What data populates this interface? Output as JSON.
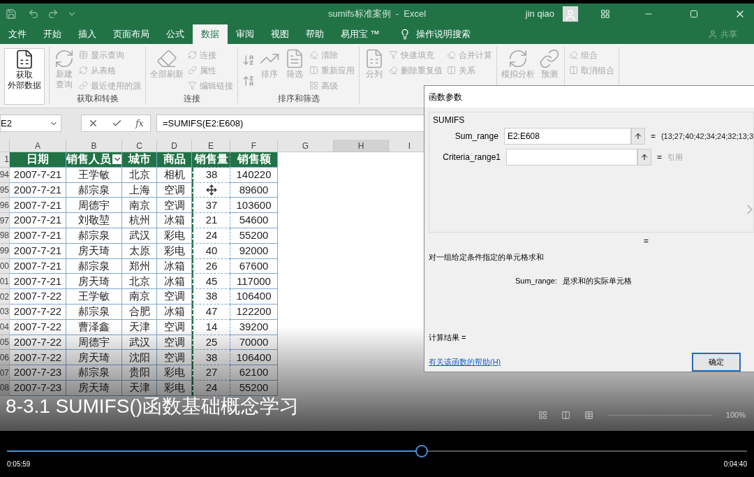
{
  "window": {
    "title": "sumifs标准案例  -  Excel",
    "user": "jin qiao"
  },
  "tabs": [
    {
      "label": "文件",
      "selected": false
    },
    {
      "label": "开始",
      "selected": false
    },
    {
      "label": "插入",
      "selected": false
    },
    {
      "label": "页面布局",
      "selected": false
    },
    {
      "label": "公式",
      "selected": false
    },
    {
      "label": "数据",
      "selected": true
    },
    {
      "label": "审阅",
      "selected": false
    },
    {
      "label": "视图",
      "selected": false
    },
    {
      "label": "帮助",
      "selected": false
    },
    {
      "label": "易用宝 ™",
      "selected": false
    }
  ],
  "tell_me": "操作说明搜索",
  "share": "共享",
  "ribbon": {
    "groups": [
      {
        "items": [
          {
            "lines": [
              "获取",
              "外部数据"
            ],
            "kind": "large",
            "disabled": false
          }
        ]
      },
      {
        "label": "获取和转换",
        "items": [
          {
            "lines": [
              "新建",
              "查询"
            ],
            "kind": "large",
            "disabled": true
          },
          {
            "kind": "stack",
            "items": [
              {
                "label": "显示查询",
                "disabled": true
              },
              {
                "label": "从表格",
                "disabled": true
              },
              {
                "label": "最近使用的源",
                "disabled": true
              }
            ]
          }
        ]
      },
      {
        "label": "连接",
        "items": [
          {
            "lines": [
              "全部刷新"
            ],
            "kind": "large",
            "disabled": true
          },
          {
            "kind": "stack",
            "items": [
              {
                "label": "连接",
                "disabled": true
              },
              {
                "label": "属性",
                "disabled": true
              },
              {
                "label": "编辑链接",
                "disabled": true
              }
            ]
          }
        ]
      },
      {
        "label": "排序和筛选",
        "items": [
          {
            "kind": "sort",
            "disabled": true
          },
          {
            "lines": [
              "排序"
            ],
            "kind": "large",
            "disabled": true
          },
          {
            "lines": [
              "筛选"
            ],
            "kind": "large",
            "disabled": true
          },
          {
            "kind": "stack",
            "items": [
              {
                "label": "清除",
                "disabled": true
              },
              {
                "label": "重新应用",
                "disabled": true
              },
              {
                "label": "高级",
                "disabled": true
              }
            ]
          }
        ]
      },
      {
        "items": [
          {
            "lines": [
              "分列"
            ],
            "kind": "large",
            "disabled": true
          },
          {
            "kind": "stack",
            "items": [
              {
                "label": "快速填充",
                "disabled": true
              },
              {
                "label": "删除重复值",
                "disabled": true
              }
            ]
          },
          {
            "kind": "stack",
            "items": [
              {
                "label": "合并计算",
                "disabled": true
              },
              {
                "label": "关系",
                "disabled": true
              }
            ]
          }
        ]
      },
      {
        "items": [
          {
            "lines": [
              "模拟分析"
            ],
            "kind": "large",
            "disabled": true
          },
          {
            "lines": [
              "预测"
            ],
            "kind": "large",
            "disabled": true
          }
        ]
      },
      {
        "items": [
          {
            "kind": "stack",
            "items": [
              {
                "label": "组合",
                "disabled": true
              },
              {
                "label": "取消组合",
                "disabled": true
              }
            ]
          }
        ]
      }
    ]
  },
  "name_box": "E2",
  "fx": "fx",
  "formula": "=SUMIFS(E2:E608)",
  "sheet": {
    "columns": [
      "A",
      "B",
      "C",
      "D",
      "E",
      "F",
      "G",
      "H",
      "I"
    ],
    "header_row": {
      "number": "1",
      "cells": [
        "日期",
        "销售人员",
        "城市",
        "商品",
        "销售量",
        "销售额"
      ]
    },
    "rows": [
      {
        "number": "94",
        "cells": [
          "2007-7-21",
          "王学敏",
          "北京",
          "相机",
          "38",
          "140220"
        ]
      },
      {
        "number": "95",
        "cells": [
          "2007-7-21",
          "郝宗泉",
          "上海",
          "空调",
          null,
          "89600"
        ]
      },
      {
        "number": "96",
        "cells": [
          "2007-7-21",
          "周德宇",
          "南京",
          "空调",
          "37",
          "103600"
        ]
      },
      {
        "number": "97",
        "cells": [
          "2007-7-21",
          "刘敬堃",
          "杭州",
          "冰箱",
          "21",
          "54600"
        ]
      },
      {
        "number": "98",
        "cells": [
          "2007-7-21",
          "郝宗泉",
          "武汉",
          "彩电",
          "24",
          "55200"
        ]
      },
      {
        "number": "99",
        "cells": [
          "2007-7-21",
          "房天琦",
          "太原",
          "彩电",
          "40",
          "92000"
        ]
      },
      {
        "number": "00",
        "cells": [
          "2007-7-21",
          "郝宗泉",
          "郑州",
          "冰箱",
          "26",
          "67600"
        ]
      },
      {
        "number": "01",
        "cells": [
          "2007-7-21",
          "房天琦",
          "北京",
          "冰箱",
          "45",
          "117000"
        ]
      },
      {
        "number": "02",
        "cells": [
          "2007-7-22",
          "王学敏",
          "南京",
          "空调",
          "38",
          "106400"
        ]
      },
      {
        "number": "03",
        "cells": [
          "2007-7-22",
          "郝宗泉",
          "合肥",
          "冰箱",
          "47",
          "122200"
        ]
      },
      {
        "number": "04",
        "cells": [
          "2007-7-22",
          "曹泽鑫",
          "天津",
          "空调",
          "14",
          "39200"
        ]
      },
      {
        "number": "05",
        "cells": [
          "2007-7-22",
          "周德宇",
          "武汉",
          "空调",
          "25",
          "70000"
        ]
      },
      {
        "number": "06",
        "cells": [
          "2007-7-22",
          "房天琦",
          "沈阳",
          "空调",
          "38",
          "106400"
        ]
      },
      {
        "number": "07",
        "cells": [
          "2007-7-23",
          "郝宗泉",
          "贵阳",
          "彩电",
          "27",
          "62100"
        ]
      },
      {
        "number": "08",
        "cells": [
          "2007-7-23",
          "房天琦",
          "天津",
          "彩电",
          "24",
          "55200"
        ]
      }
    ]
  },
  "zoom": "100%",
  "dialog": {
    "title": "函数参数",
    "function": "SUMIFS",
    "args": [
      {
        "label": "Sum_range",
        "value": "E2:E608",
        "result": "{13;27;40;42;34;24;32;13;3",
        "dimmed": false
      },
      {
        "label": "Criteria_range1",
        "result": "引用",
        "dimmed": true
      }
    ],
    "equals": "=",
    "description": "对一组给定条件指定的单元格求和",
    "arg_help_label": "Sum_range:",
    "arg_help_text": "是求和的实际单元格",
    "result_label": "计算结果 =",
    "help_link": "有关该函数的帮助(H)",
    "ok": "确定"
  },
  "video": {
    "caption": "8-3.1 SUMIFS()函数基础概念学习",
    "level": 0.56,
    "elapsed": "0:05:59",
    "remaining": "0:04:40"
  }
}
